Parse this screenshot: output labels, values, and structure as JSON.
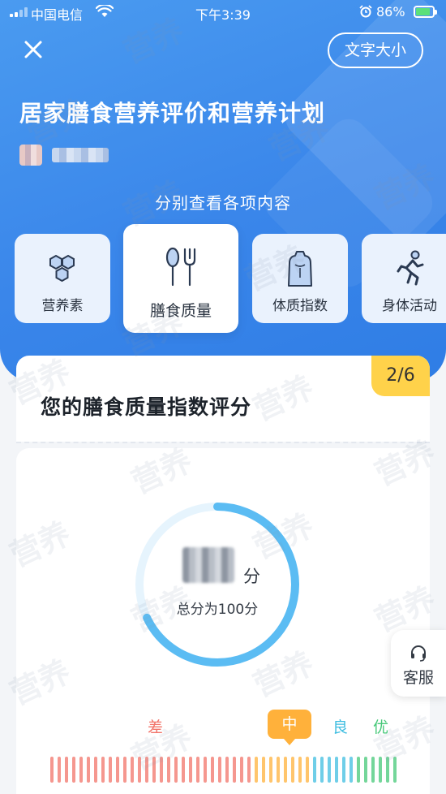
{
  "status_bar": {
    "carrier": "中国电信",
    "time": "下午3:39",
    "battery_percent": "86%",
    "battery_color": "#5be07a"
  },
  "header": {
    "close_icon": "close-icon",
    "font_size_button": "文字大小",
    "title": "居家膳食营养评价和营养计划",
    "subtitle": "分别查看各项内容"
  },
  "tabs": [
    {
      "label": "营养素",
      "icon": "hexagon-cluster-icon",
      "active": false
    },
    {
      "label": "膳食质量",
      "icon": "spoon-fork-icon",
      "active": true
    },
    {
      "label": "体质指数",
      "icon": "body-torso-icon",
      "active": false
    },
    {
      "label": "身体活动",
      "icon": "running-person-icon",
      "active": false
    }
  ],
  "card": {
    "title": "您的膳食质量指数评分",
    "page_badge": "2/6",
    "score_unit": "分",
    "score_total": "总分为100分",
    "ring_color": "#5bbcf3"
  },
  "grades": {
    "poor": "差",
    "mid": "中",
    "good": "良",
    "excellent": "优",
    "colors": {
      "poor": "#f2746a",
      "mid": "#ffb13b",
      "good": "#3fbde0",
      "excellent": "#46c878"
    }
  },
  "customer_service": {
    "label": "客服",
    "icon": "headset-icon"
  },
  "watermark_text": "营养"
}
